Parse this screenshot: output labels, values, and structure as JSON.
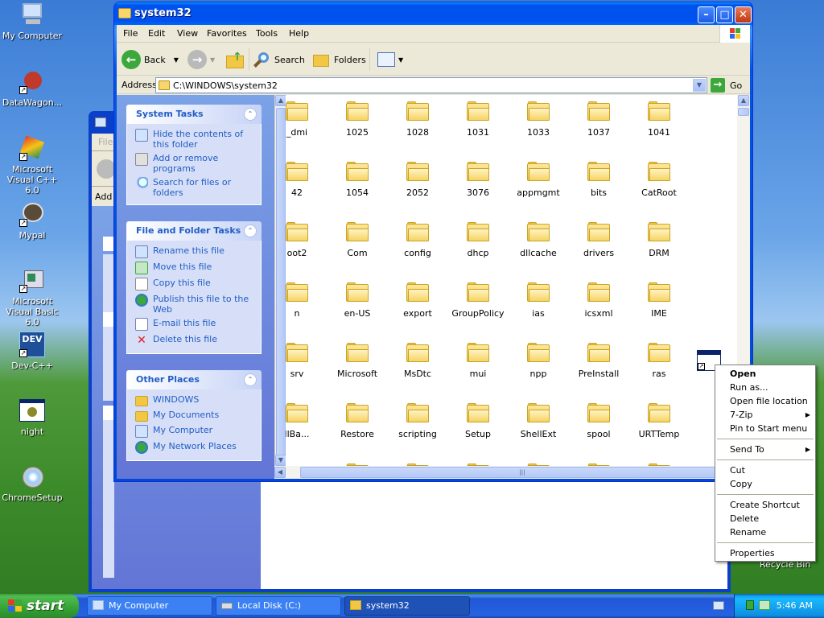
{
  "desktop": {
    "icons": [
      {
        "label": "My Computer"
      },
      {
        "label": "DataWagon..."
      },
      {
        "label": "Microsoft Visual C++ 6.0"
      },
      {
        "label": "Mypal"
      },
      {
        "label": "Microsoft Visual Basic 6.0"
      },
      {
        "label": "Dev-C++"
      },
      {
        "label": "night"
      },
      {
        "label": "ChromeSetup"
      }
    ],
    "recycle_bin_label": "Recycle Bin",
    "dev_badge": "DEV"
  },
  "back_window": {
    "partial_texts": [
      "File",
      "Add"
    ]
  },
  "window": {
    "title": "system32",
    "menu": [
      "File",
      "Edit",
      "View",
      "Favorites",
      "Tools",
      "Help"
    ],
    "toolbar": {
      "back": "Back",
      "search": "Search",
      "folders": "Folders"
    },
    "address": {
      "label": "Address",
      "value": "C:\\WINDOWS\\system32",
      "go": "Go"
    }
  },
  "task_pane": {
    "system_tasks": {
      "title": "System Tasks",
      "items": [
        "Hide the contents of this folder",
        "Add or remove programs",
        "Search for files or folders"
      ]
    },
    "file_tasks": {
      "title": "File and Folder Tasks",
      "items": [
        "Rename this file",
        "Move this file",
        "Copy this file",
        "Publish this file to the Web",
        "E-mail this file",
        "Delete this file"
      ]
    },
    "other_places": {
      "title": "Other Places",
      "items": [
        "WINDOWS",
        "My Documents",
        "My Computer",
        "My Network Places"
      ]
    }
  },
  "files": [
    [
      "_dmi",
      "1025",
      "1028",
      "1031",
      "1033",
      "1037",
      "1041"
    ],
    [
      "42",
      "1054",
      "2052",
      "3076",
      "appmgmt",
      "bits",
      "CatRoot"
    ],
    [
      "oot2",
      "Com",
      "config",
      "dhcp",
      "dllcache",
      "drivers",
      "DRM"
    ],
    [
      "n",
      "en-US",
      "export",
      "GroupPolicy",
      "ias",
      "icsxml",
      "IME"
    ],
    [
      "srv",
      "Microsoft",
      "MsDtc",
      "mui",
      "npp",
      "PreInstall",
      "ras"
    ],
    [
      "llBa...",
      "Restore",
      "scripting",
      "Setup",
      "ShellExt",
      "spool",
      "URTTemp"
    ]
  ],
  "context_menu": {
    "groups": [
      [
        {
          "label": "Open",
          "bold": true
        },
        {
          "label": "Run as..."
        },
        {
          "label": "Open file location"
        },
        {
          "label": "7-Zip",
          "submenu": true
        },
        {
          "label": "Pin to Start menu"
        }
      ],
      [
        {
          "label": "Send To",
          "submenu": true
        }
      ],
      [
        {
          "label": "Cut"
        },
        {
          "label": "Copy"
        }
      ],
      [
        {
          "label": "Create Shortcut"
        },
        {
          "label": "Delete"
        },
        {
          "label": "Rename"
        }
      ],
      [
        {
          "label": "Properties"
        }
      ]
    ]
  },
  "taskbar": {
    "start": "start",
    "tasks": [
      {
        "label": "My Computer",
        "active": false
      },
      {
        "label": "Local Disk (C:)",
        "active": false
      },
      {
        "label": "system32",
        "active": true
      }
    ],
    "clock": "5:46 AM"
  },
  "colors": {
    "title_blue": "#0053ee",
    "taskpane_link": "#215dc6",
    "start_green": "#36a236",
    "folder_yellow": "#f2c744"
  }
}
